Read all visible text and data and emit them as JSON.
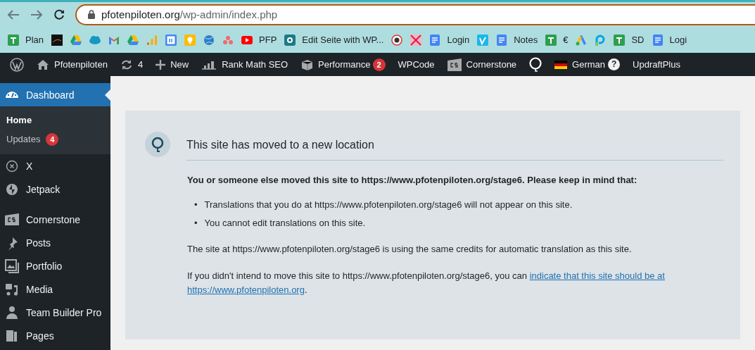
{
  "browser": {
    "url_host": "pfotenpiloten.org",
    "url_path": "/wp-admin/index.php",
    "bookmarks": [
      {
        "kind": "sheet",
        "label": "Plan"
      },
      {
        "kind": "dark"
      },
      {
        "kind": "drive"
      },
      {
        "kind": "cloud"
      },
      {
        "kind": "mail"
      },
      {
        "kind": "drive"
      },
      {
        "kind": "bars"
      },
      {
        "kind": "calendar"
      },
      {
        "kind": "bulb"
      },
      {
        "kind": "globe"
      },
      {
        "kind": "dots"
      },
      {
        "kind": "video",
        "label": "PFP"
      },
      {
        "kind": "teal",
        "label": "Edit Seite with WP..."
      },
      {
        "kind": "round"
      },
      {
        "kind": "pink"
      },
      {
        "kind": "doc",
        "label": "Login"
      },
      {
        "kind": "vimeo"
      },
      {
        "kind": "doc",
        "label": "Notes"
      },
      {
        "kind": "sheet",
        "label": "€"
      },
      {
        "kind": "ads"
      },
      {
        "kind": "p"
      },
      {
        "kind": "sheet",
        "label": "SD"
      },
      {
        "kind": "doc",
        "label": "Logi"
      }
    ]
  },
  "admin_bar": [
    {
      "kind": "wp"
    },
    {
      "kind": "home",
      "label": "Pfotenpiloten"
    },
    {
      "kind": "sync",
      "label": "4"
    },
    {
      "kind": "plus",
      "label": "New"
    },
    {
      "kind": "chart",
      "label": "Rank Math SEO"
    },
    {
      "kind": "box",
      "label": "Performance",
      "badge": "2"
    },
    {
      "kind": "text",
      "label": "WPCode"
    },
    {
      "kind": "cs",
      "label": "Cornerstone"
    },
    {
      "kind": "bubble"
    },
    {
      "kind": "flag",
      "label": "German",
      "help": "?"
    },
    {
      "kind": "text",
      "label": "UpdraftPlus"
    }
  ],
  "sidebar": {
    "groups": [
      {
        "items": [
          {
            "kind": "gauge",
            "label": "Dashboard",
            "selected": true,
            "children": [
              {
                "label": "Home",
                "selected": true
              },
              {
                "label": "Updates",
                "selected": false,
                "badge": "4"
              }
            ]
          },
          {
            "kind": "x",
            "label": "X",
            "selected": false
          },
          {
            "kind": "bolt",
            "label": "Jetpack",
            "selected": false
          }
        ]
      },
      {
        "items": [
          {
            "kind": "cs",
            "label": "Cornerstone",
            "selected": false
          },
          {
            "kind": "pin",
            "label": "Posts",
            "selected": false
          },
          {
            "kind": "gallery",
            "label": "Portfolio",
            "selected": false
          },
          {
            "kind": "media",
            "label": "Media",
            "selected": false
          },
          {
            "kind": "person",
            "label": "Team Builder Pro",
            "selected": false
          },
          {
            "kind": "pages",
            "label": "Pages",
            "selected": false
          }
        ]
      }
    ]
  },
  "notice": {
    "title": "This site has moved to a new location",
    "lead": "You or someone else moved this site to https://www.pfotenpiloten.org/stage6. Please keep in mind that:",
    "bullet": "•",
    "bullets": [
      "Translations that you do at https://www.pfotenpiloten.org/stage6 will not appear on this site.",
      "You cannot edit translations on this site."
    ],
    "paragraph": "The site at https://www.pfotenpiloten.org/stage6 is using the same credits for automatic translation as this site.",
    "closing": "If you didn't intend to move this site to https://www.pfotenpiloten.org/stage6, you can ",
    "link_lines": [
      "indicate that this site should be at",
      "https://www.pfotenpiloten.org"
    ],
    "after_link": "."
  }
}
